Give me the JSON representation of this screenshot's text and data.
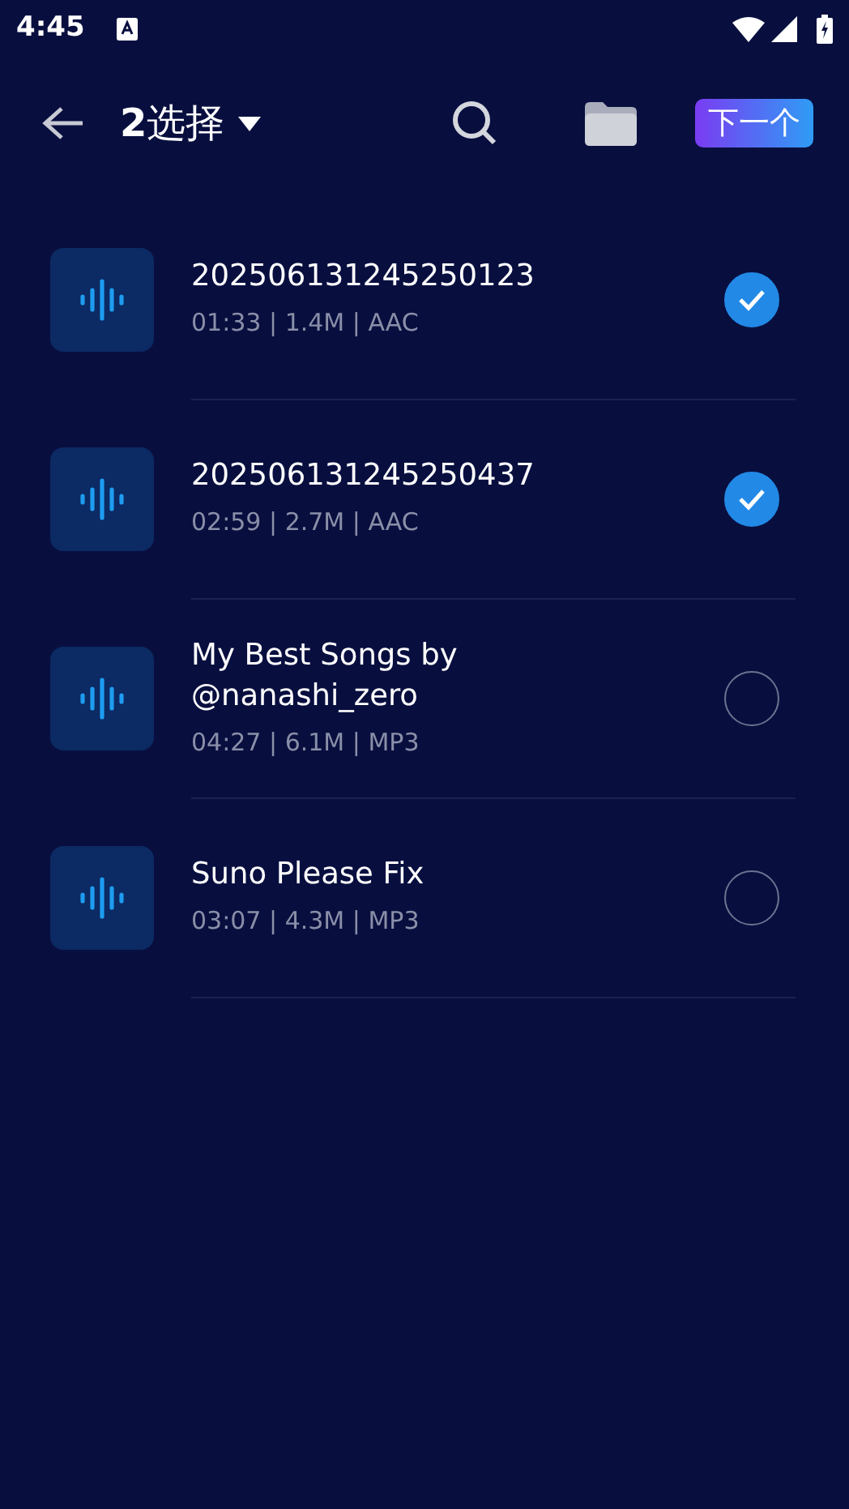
{
  "status_bar": {
    "time": "4:45"
  },
  "toolbar": {
    "title": "**2**选择",
    "next_button": "下一个"
  },
  "files": [
    {
      "name": "202506131245250123",
      "meta": "01:33 | 1.4M | AAC",
      "selected": true
    },
    {
      "name": "202506131245250437",
      "meta": "02:59 | 2.7M | AAC",
      "selected": true
    },
    {
      "name": "My Best Songs by @nanashi_zero",
      "meta": "04:27 | 6.1M | MP3",
      "selected": false
    },
    {
      "name": "Suno Please Fix",
      "meta": "03:07 | 4.3M | MP3",
      "selected": false
    }
  ]
}
